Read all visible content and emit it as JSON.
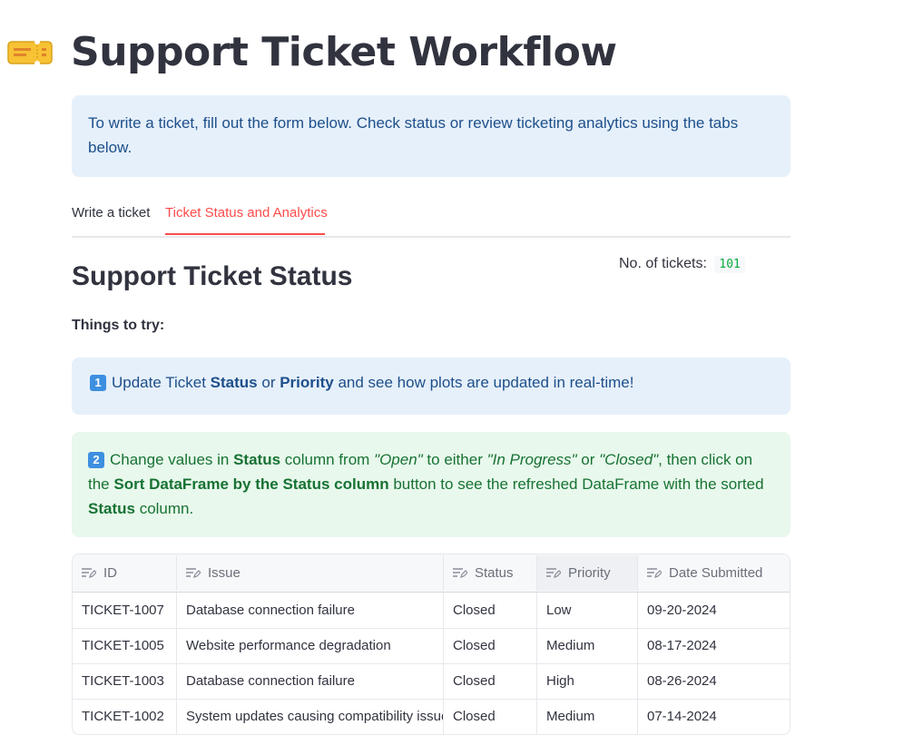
{
  "page": {
    "title": "Support Ticket Workflow",
    "info": "To write a ticket, fill out the form below. Check status or review ticketing analytics using the tabs below."
  },
  "tabs": [
    {
      "label": "Write a ticket",
      "active": false
    },
    {
      "label": "Ticket Status and Analytics",
      "active": true
    }
  ],
  "status_section": {
    "title": "Support Ticket Status",
    "metric_label": "No. of tickets:",
    "metric_value": "101",
    "things_to_try": "Things to try:",
    "tip1": {
      "number": "1",
      "prefix": "Update Ticket ",
      "status": "Status",
      "or": " or ",
      "priority": "Priority",
      "suffix": " and see how plots are updated in real-time!"
    },
    "tip2": {
      "number": "2",
      "t1": "Change values in ",
      "status": "Status",
      "t2": " column from ",
      "open": "\"Open\"",
      "t3": " to either ",
      "in_progress": "\"In Progress\"",
      "t4": " or ",
      "closed": "\"Closed\"",
      "t5": ", then click on the ",
      "sort_button": "Sort DataFrame by the Status column",
      "t6": " button to see the refreshed DataFrame with the sorted ",
      "status2": "Status",
      "t7": " column."
    }
  },
  "table": {
    "columns": [
      "ID",
      "Issue",
      "Status",
      "Priority",
      "Date Submitted"
    ],
    "rows": [
      [
        "TICKET-1007",
        "Database connection failure",
        "Closed",
        "Low",
        "09-20-2024"
      ],
      [
        "TICKET-1005",
        "Website performance degradation",
        "Closed",
        "Medium",
        "08-17-2024"
      ],
      [
        "TICKET-1003",
        "Database connection failure",
        "Closed",
        "High",
        "08-26-2024"
      ],
      [
        "TICKET-1002",
        "System updates causing compatibility issue",
        "Closed",
        "Medium",
        "07-14-2024"
      ]
    ]
  },
  "colors": {
    "accent": "#ff4b4b",
    "info_bg": "#e6f0fb",
    "success_bg": "#e8f8ec",
    "metric_green": "#09ab3b"
  },
  "icons": {
    "title": "ticket-icon",
    "column_header": "edit-column-icon"
  }
}
